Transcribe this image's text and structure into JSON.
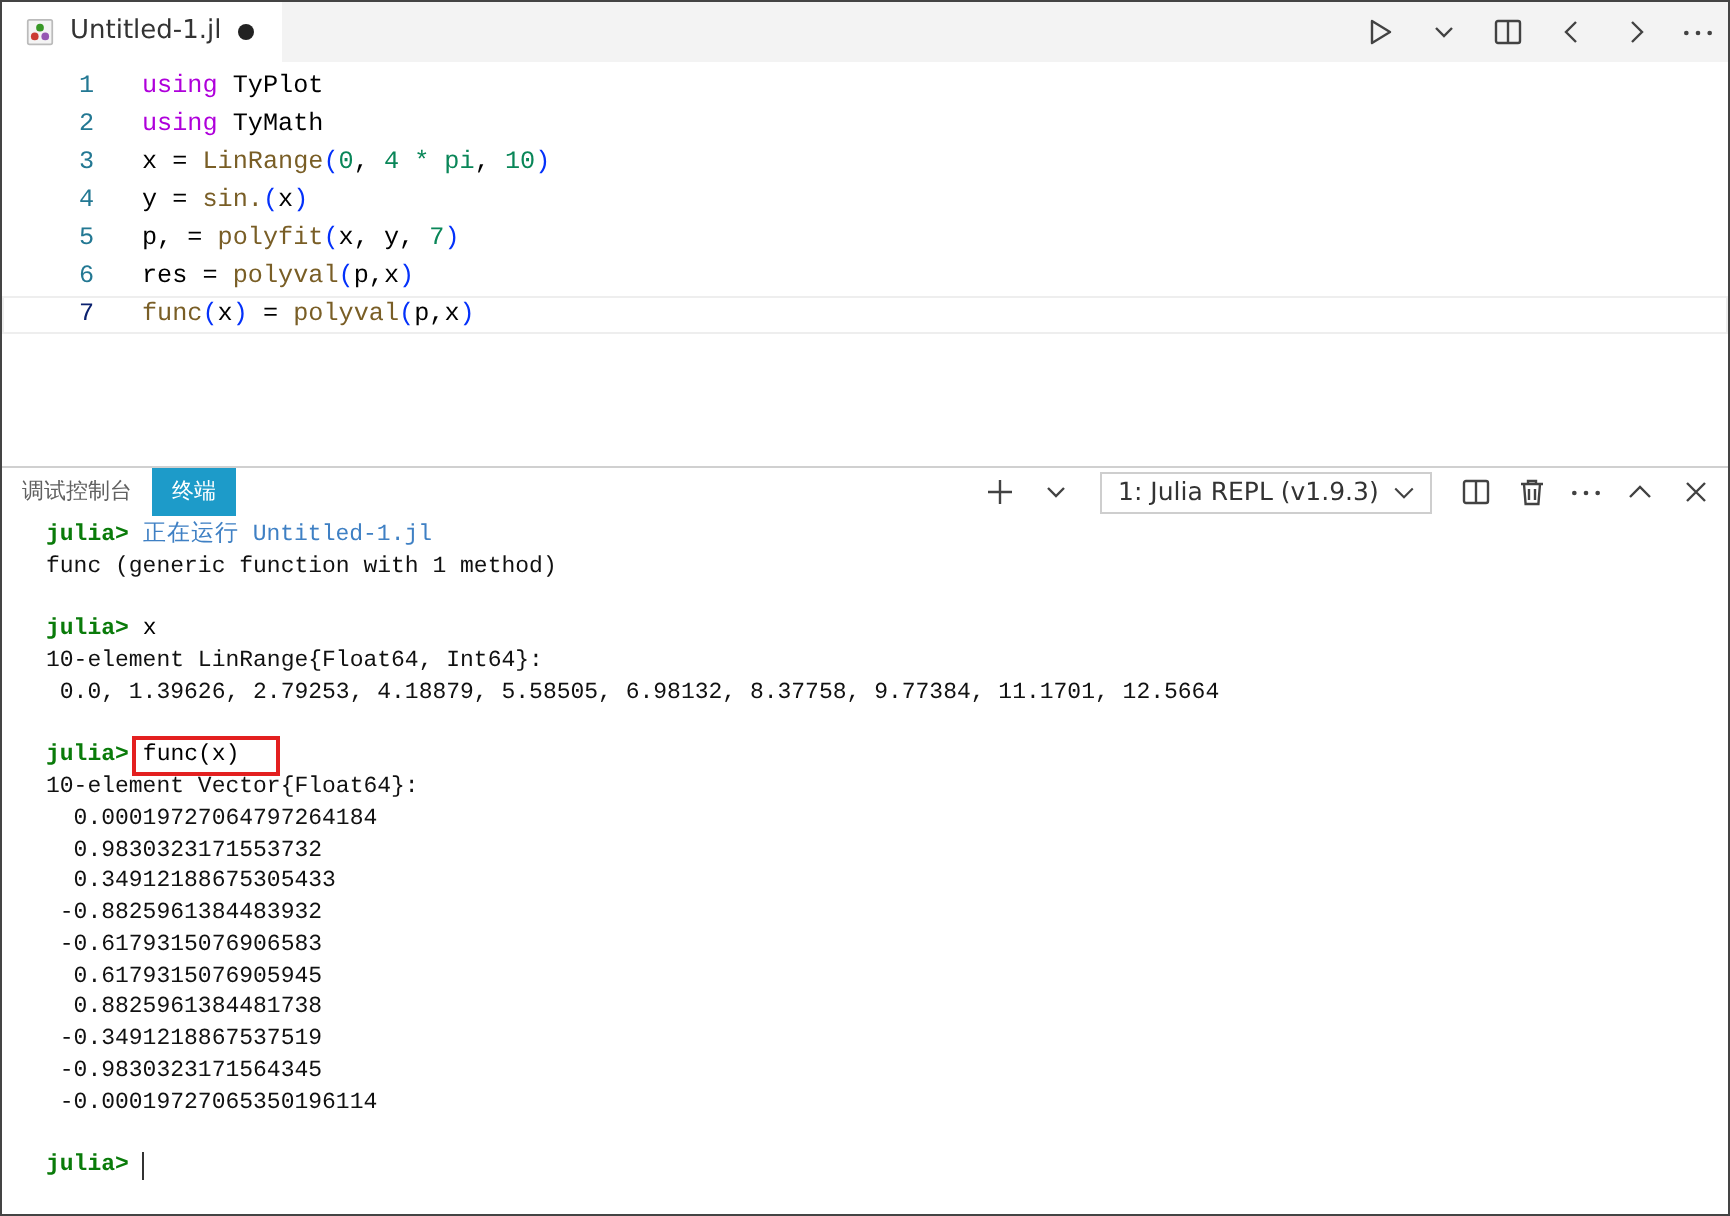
{
  "editor_tab": {
    "label": "Untitled-1.jl",
    "dirty": true
  },
  "editor": {
    "lines": [
      {
        "number": "1",
        "current": false,
        "tokens": [
          {
            "text": "using",
            "kind": "keyword"
          },
          {
            "text": " TyPlot",
            "kind": "plain"
          }
        ]
      },
      {
        "number": "2",
        "current": false,
        "tokens": [
          {
            "text": "using",
            "kind": "keyword"
          },
          {
            "text": " TyMath",
            "kind": "plain"
          }
        ]
      },
      {
        "number": "3",
        "current": false,
        "tokens": [
          {
            "text": "x = ",
            "kind": "plain"
          },
          {
            "text": "LinRange",
            "kind": "function"
          },
          {
            "text": "(",
            "kind": "bracket"
          },
          {
            "text": "0",
            "kind": "number"
          },
          {
            "text": ", ",
            "kind": "plain"
          },
          {
            "text": "4 * pi",
            "kind": "number"
          },
          {
            "text": ", ",
            "kind": "plain"
          },
          {
            "text": "10",
            "kind": "number"
          },
          {
            "text": ")",
            "kind": "bracket"
          }
        ]
      },
      {
        "number": "4",
        "current": false,
        "tokens": [
          {
            "text": "y = ",
            "kind": "plain"
          },
          {
            "text": "sin.",
            "kind": "function"
          },
          {
            "text": "(",
            "kind": "bracket"
          },
          {
            "text": "x",
            "kind": "plain"
          },
          {
            "text": ")",
            "kind": "bracket"
          }
        ]
      },
      {
        "number": "5",
        "current": false,
        "tokens": [
          {
            "text": "p, = ",
            "kind": "plain"
          },
          {
            "text": "polyfit",
            "kind": "function"
          },
          {
            "text": "(",
            "kind": "bracket"
          },
          {
            "text": "x, y, ",
            "kind": "plain"
          },
          {
            "text": "7",
            "kind": "number"
          },
          {
            "text": ")",
            "kind": "bracket"
          }
        ]
      },
      {
        "number": "6",
        "current": false,
        "tokens": [
          {
            "text": "res = ",
            "kind": "plain"
          },
          {
            "text": "polyval",
            "kind": "function"
          },
          {
            "text": "(",
            "kind": "bracket"
          },
          {
            "text": "p,x",
            "kind": "plain"
          },
          {
            "text": ")",
            "kind": "bracket"
          }
        ]
      },
      {
        "number": "7",
        "current": true,
        "tokens": [
          {
            "text": "func",
            "kind": "function"
          },
          {
            "text": "(",
            "kind": "bracket"
          },
          {
            "text": "x",
            "kind": "plain"
          },
          {
            "text": ")",
            "kind": "bracket"
          },
          {
            "text": " = ",
            "kind": "plain"
          },
          {
            "text": "polyval",
            "kind": "function"
          },
          {
            "text": "(",
            "kind": "bracket"
          },
          {
            "text": "p,x",
            "kind": "plain"
          },
          {
            "text": ")",
            "kind": "bracket"
          }
        ]
      }
    ]
  },
  "panel_tabs": [
    {
      "label": "调试控制台",
      "selected": false
    },
    {
      "label": "终端",
      "selected": true
    }
  ],
  "terminal_select": {
    "value": "1: Julia REPL (v1.9.3)"
  },
  "terminal": {
    "lines": [
      {
        "kind": "prompt",
        "prompt": "julia>",
        "input": "正在运行 Untitled-1.jl",
        "notice": true,
        "boxed": false
      },
      {
        "kind": "output",
        "text": "func (generic function with 1 method)"
      },
      {
        "kind": "blank"
      },
      {
        "kind": "prompt",
        "prompt": "julia>",
        "input": "x",
        "notice": false,
        "boxed": false
      },
      {
        "kind": "output",
        "text": "10-element LinRange{Float64, Int64}:"
      },
      {
        "kind": "output",
        "text": " 0.0, 1.39626, 2.79253, 4.18879, 5.58505, 6.98132, 8.37758, 9.77384, 11.1701, 12.5664"
      },
      {
        "kind": "blank"
      },
      {
        "kind": "prompt",
        "prompt": "julia>",
        "input": "func(x)",
        "notice": false,
        "boxed": true
      },
      {
        "kind": "output",
        "text": "10-element Vector{Float64}:"
      },
      {
        "kind": "output",
        "text": "  0.00019727064797264184"
      },
      {
        "kind": "output",
        "text": "  0.9830323171553732"
      },
      {
        "kind": "output",
        "text": "  0.34912188675305433"
      },
      {
        "kind": "output",
        "text": " -0.8825961384483932"
      },
      {
        "kind": "output",
        "text": " -0.6179315076906583"
      },
      {
        "kind": "output",
        "text": "  0.6179315076905945"
      },
      {
        "kind": "output",
        "text": "  0.8825961384481738"
      },
      {
        "kind": "output",
        "text": " -0.3491218867537519"
      },
      {
        "kind": "output",
        "text": " -0.9830323171564345"
      },
      {
        "kind": "output",
        "text": " -0.00019727065350196114"
      },
      {
        "kind": "blank"
      },
      {
        "kind": "cursor_prompt",
        "prompt": "julia>"
      }
    ]
  }
}
